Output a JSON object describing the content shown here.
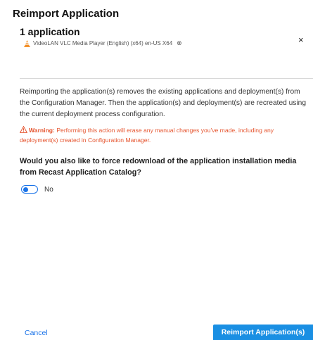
{
  "dialog": {
    "title": "Reimport Application",
    "count_label": "1 application",
    "app_chip": {
      "label": "VideoLAN VLC Media Player (English) (x64) en-US X64",
      "remove_symbol": "⊗",
      "icon": "vlc-cone-icon"
    },
    "close_symbol": "×",
    "description": "Reimporting the application(s) removes the existing applications and deployment(s) from the Configuration Manager. Then the application(s) and deployment(s) are recreated using the current deployment process configuration.",
    "warning": {
      "label": "Warning:",
      "text": "Performing this action will erase any manual changes you've made, including any deployment(s) created in Configuration Manager.",
      "icon": "warning-triangle-icon"
    },
    "question": "Would you also like to force redownload of the application installation media from Recast Application Catalog?",
    "toggle": {
      "label": "No",
      "state": "off"
    },
    "footer": {
      "cancel_label": "Cancel",
      "primary_label": "Reimport Application(s)"
    },
    "colors": {
      "accent": "#1a73e8",
      "primary_button": "#1a8fe3",
      "warning": "#e5532d"
    }
  }
}
